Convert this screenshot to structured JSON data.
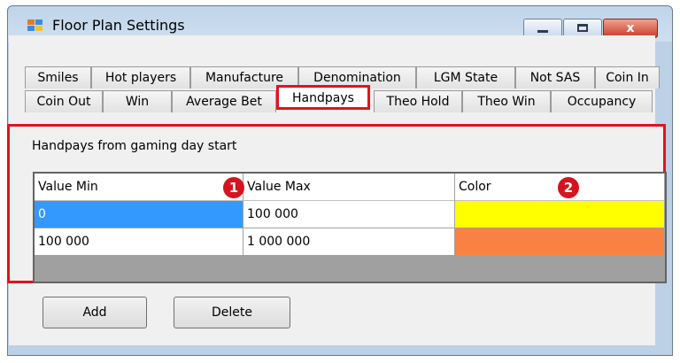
{
  "window": {
    "title": "Floor Plan Settings"
  },
  "titlebar_buttons": {
    "close_label": "x"
  },
  "tabs_row1": [
    "Smiles",
    "Hot players",
    "Manufacture",
    "Denomination",
    "LGM State",
    "Not SAS",
    "Coin In"
  ],
  "tabs_row2": [
    "Coin Out",
    "Win",
    "Average Bet",
    "Handpays",
    "Theo Hold",
    "Theo Win",
    "Occupancy"
  ],
  "active_tab": "Handpays",
  "panel": {
    "label": "Handpays from gaming day start"
  },
  "grid": {
    "columns": [
      "Value Min",
      "Value Max",
      "Color"
    ],
    "rows": [
      {
        "min": "0",
        "max": "100 000",
        "color": "#ffff00"
      },
      {
        "min": "100 000",
        "max": "1 000 000",
        "color": "#f98141"
      }
    ]
  },
  "badges": [
    "1",
    "2"
  ],
  "buttons": {
    "add": "Add",
    "delete": "Delete"
  }
}
